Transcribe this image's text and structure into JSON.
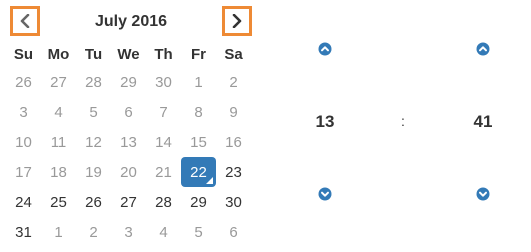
{
  "calendar": {
    "month_title": "July 2016",
    "weekdays": [
      "Su",
      "Mo",
      "Tu",
      "We",
      "Th",
      "Fr",
      "Sa"
    ],
    "weeks": [
      [
        {
          "d": "26",
          "s": "old"
        },
        {
          "d": "27",
          "s": "old"
        },
        {
          "d": "28",
          "s": "old"
        },
        {
          "d": "29",
          "s": "old"
        },
        {
          "d": "30",
          "s": "old"
        },
        {
          "d": "1",
          "s": "old"
        },
        {
          "d": "2",
          "s": "old"
        }
      ],
      [
        {
          "d": "3",
          "s": "old"
        },
        {
          "d": "4",
          "s": "old"
        },
        {
          "d": "5",
          "s": "old"
        },
        {
          "d": "6",
          "s": "old"
        },
        {
          "d": "7",
          "s": "old"
        },
        {
          "d": "8",
          "s": "old"
        },
        {
          "d": "9",
          "s": "old"
        }
      ],
      [
        {
          "d": "10",
          "s": "old"
        },
        {
          "d": "11",
          "s": "old"
        },
        {
          "d": "12",
          "s": "old"
        },
        {
          "d": "13",
          "s": "old"
        },
        {
          "d": "14",
          "s": "old"
        },
        {
          "d": "15",
          "s": "old"
        },
        {
          "d": "16",
          "s": "old"
        }
      ],
      [
        {
          "d": "17",
          "s": "old"
        },
        {
          "d": "18",
          "s": "old"
        },
        {
          "d": "19",
          "s": "old"
        },
        {
          "d": "20",
          "s": "old"
        },
        {
          "d": "21",
          "s": "old"
        },
        {
          "d": "22",
          "s": "active"
        },
        {
          "d": "23",
          "s": ""
        }
      ],
      [
        {
          "d": "24",
          "s": ""
        },
        {
          "d": "25",
          "s": ""
        },
        {
          "d": "26",
          "s": ""
        },
        {
          "d": "27",
          "s": ""
        },
        {
          "d": "28",
          "s": ""
        },
        {
          "d": "29",
          "s": ""
        },
        {
          "d": "30",
          "s": ""
        }
      ],
      [
        {
          "d": "31",
          "s": ""
        },
        {
          "d": "1",
          "s": "new"
        },
        {
          "d": "2",
          "s": "new"
        },
        {
          "d": "3",
          "s": "new"
        },
        {
          "d": "4",
          "s": "new"
        },
        {
          "d": "5",
          "s": "new"
        },
        {
          "d": "6",
          "s": "new"
        }
      ]
    ],
    "prev_icon": "chevron-left-icon",
    "next_icon": "chevron-right-icon"
  },
  "time": {
    "hour": "13",
    "minute": "41",
    "separator": ":",
    "up_icon": "chevron-up-circle-icon",
    "down_icon": "chevron-down-circle-icon"
  },
  "colors": {
    "highlight_border": "#ee8a35",
    "active_day": "#337ab7",
    "arrow": "#337ab7",
    "muted_day": "#999999",
    "text": "#333333"
  }
}
